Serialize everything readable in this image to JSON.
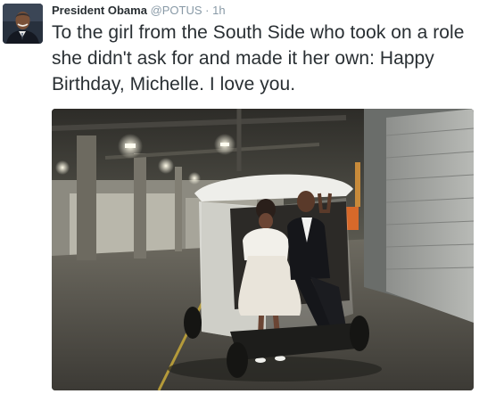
{
  "tweet": {
    "author_name": "President Obama",
    "handle": "@POTUS",
    "separator": "·",
    "timestamp": "1h",
    "text": "To the girl from the South Side who took on a role she didn't ask for and made it her own: Happy Birthday, Michelle. I love you."
  },
  "icons": {
    "avatar": "profile-photo",
    "photo": "tweet-photo"
  },
  "colors": {
    "name": "#292f33",
    "meta": "#8899a6",
    "text": "#292f33"
  }
}
